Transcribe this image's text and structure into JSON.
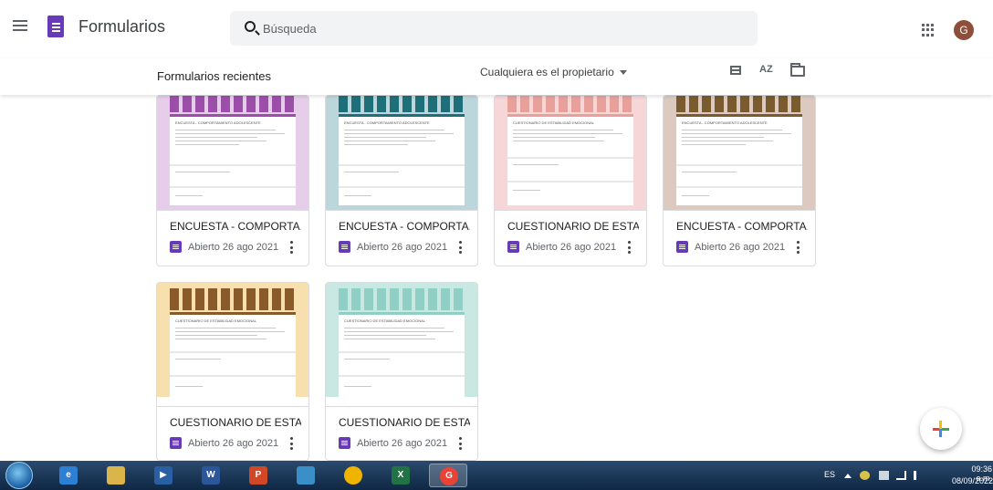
{
  "header": {
    "app_name": "Formularios",
    "search_placeholder": "Búsqueda",
    "avatar_initial": "G"
  },
  "subbar": {
    "section_title": "Formularios recientes",
    "owner_filter": "Cualquiera es el propietario",
    "sort_icon_text": "AZ"
  },
  "forms": [
    {
      "title": "ENCUESTA - COMPORTA...",
      "meta": "Abierto 26 ago 2021",
      "theme": "lavender",
      "thumb_title": "ENCUESTA - COMPORTAMIENTO ADOLESCENTE"
    },
    {
      "title": "ENCUESTA - COMPORTA...",
      "meta": "Abierto 26 ago 2021",
      "theme": "teal",
      "thumb_title": "ENCUESTA - COMPORTAMIENTO ADOLESCENTE"
    },
    {
      "title": "CUESTIONARIO DE ESTA...",
      "meta": "Abierto 26 ago 2021",
      "theme": "pink",
      "thumb_title": "CUESTIONARIO DE ESTABILIDAD EMOCIONAL"
    },
    {
      "title": "ENCUESTA - COMPORTA...",
      "meta": "Abierto 26 ago 2021",
      "theme": "taupe",
      "thumb_title": "ENCUESTA - COMPORTAMIENTO ADOLESCENTE"
    },
    {
      "title": "CUESTIONARIO DE ESTA...",
      "meta": "Abierto 26 ago 2021",
      "theme": "peach",
      "thumb_title": "CUESTIONARIO DE ESTABILIDAD EMOCIONAL"
    },
    {
      "title": "CUESTIONARIO DE ESTA...",
      "meta": "Abierto 26 ago 2021",
      "theme": "mint",
      "thumb_title": "CUESTIONARIO DE ESTABILIDAD EMOCIONAL"
    }
  ],
  "taskbar": {
    "apps": [
      {
        "name": "ie-icon",
        "color": "#2d7fd3",
        "glyph": "e"
      },
      {
        "name": "file-explorer-icon",
        "color": "#d9b54a",
        "glyph": ""
      },
      {
        "name": "media-player-icon",
        "color": "#2b5fa3",
        "glyph": "▶"
      },
      {
        "name": "word-icon",
        "color": "#2b579a",
        "glyph": "W"
      },
      {
        "name": "powerpoint-icon",
        "color": "#d24726",
        "glyph": "P"
      },
      {
        "name": "photo-viewer-icon",
        "color": "#3a8fc7",
        "glyph": ""
      },
      {
        "name": "chrome-icon",
        "color": "#f0b400",
        "glyph": ""
      },
      {
        "name": "excel-icon",
        "color": "#217346",
        "glyph": "X"
      },
      {
        "name": "chrome-active-icon",
        "color": "#ea4335",
        "glyph": "G"
      }
    ],
    "language": "ES",
    "time": "09:36 a.m.",
    "date": "08/09/2022"
  },
  "colors": {
    "forms_purple": "#673ab7",
    "lavender": "#e6cde9",
    "teal": "#bcd7dc",
    "pink": "#f6d6d6",
    "taupe": "#dccac1",
    "peach": "#f7dfae",
    "mint": "#c9e8e1"
  }
}
